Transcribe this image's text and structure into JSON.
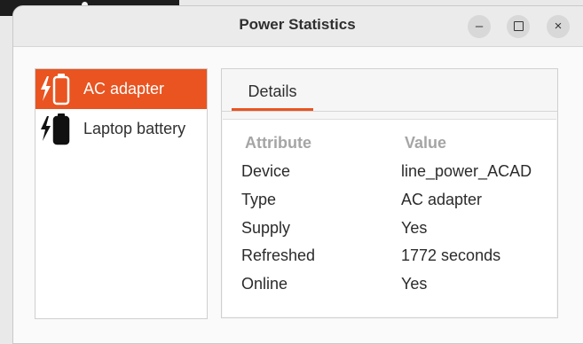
{
  "window": {
    "title": "Power Statistics",
    "buttons": {
      "minimize": "–",
      "close": "×"
    }
  },
  "devices": [
    {
      "label": "AC adapter",
      "icon": "ac-adapter-charging-icon",
      "selected": true
    },
    {
      "label": "Laptop battery",
      "icon": "battery-charging-icon",
      "selected": false
    }
  ],
  "tabs": [
    {
      "label": "Details",
      "active": true
    }
  ],
  "details": {
    "headers": {
      "attribute": "Attribute",
      "value": "Value"
    },
    "rows": [
      {
        "attribute": "Device",
        "value": "line_power_ACAD"
      },
      {
        "attribute": "Type",
        "value": "AC adapter"
      },
      {
        "attribute": "Supply",
        "value": "Yes"
      },
      {
        "attribute": "Refreshed",
        "value": "1772 seconds"
      },
      {
        "attribute": "Online",
        "value": "Yes"
      }
    ]
  },
  "colors": {
    "accent": "#e95420",
    "selected_text": "#ffffff"
  }
}
